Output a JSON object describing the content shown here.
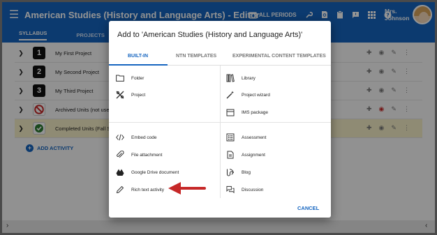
{
  "app": {
    "title": "American Studies (History and Language Arts) - Editor",
    "periods_label": "ALL PERIODS",
    "user_first": "Mrs.",
    "user_last": "Johnson"
  },
  "tabs": [
    {
      "label": "SYLLABUS",
      "active": true
    },
    {
      "label": "PROJECTS",
      "active": false
    }
  ],
  "units": [
    {
      "number": "1",
      "label": "My First Project",
      "icon": "number-1-icon"
    },
    {
      "number": "2",
      "label": "My Second Project",
      "icon": "number-2-icon"
    },
    {
      "number": "3",
      "label": "My Third Project",
      "icon": "number-3-icon"
    },
    {
      "number": "",
      "label": "Archived Units (not used",
      "icon": "no-entry-icon"
    },
    {
      "number": "",
      "label": "Completed Units (Fall Se",
      "icon": "check-icon",
      "highlight": true
    }
  ],
  "add_activity_label": "ADD ACTIVITY",
  "dialog": {
    "title": "Add to 'American Studies (History and Language Arts)'",
    "tabs": [
      "BUILT-IN",
      "NTN TEMPLATES",
      "EXPERIMENTAL CONTENT TEMPLATES"
    ],
    "left_top": [
      {
        "label": "Folder",
        "icon": "folder-icon"
      },
      {
        "label": "Project",
        "icon": "project-icon"
      }
    ],
    "right_top": [
      {
        "label": "Library",
        "icon": "library-icon"
      },
      {
        "label": "Project wizard",
        "icon": "wand-icon"
      },
      {
        "label": "IMS package",
        "icon": "package-icon"
      }
    ],
    "left_bottom": [
      {
        "label": "Embed code",
        "icon": "code-icon"
      },
      {
        "label": "File attachment",
        "icon": "paperclip-icon"
      },
      {
        "label": "Google Drive document",
        "icon": "google-drive-icon"
      },
      {
        "label": "Rich text activity",
        "icon": "pencil-icon"
      }
    ],
    "right_bottom": [
      {
        "label": "Assessment",
        "icon": "assessment-icon"
      },
      {
        "label": "Assignment",
        "icon": "assignment-icon"
      },
      {
        "label": "Blog",
        "icon": "blog-icon"
      },
      {
        "label": "Discussion",
        "icon": "discussion-icon"
      }
    ],
    "cancel_label": "CANCEL"
  },
  "colors": {
    "primary": "#1565c0",
    "highlight_row": "#f7f0c8",
    "arrow": "#c62828"
  }
}
